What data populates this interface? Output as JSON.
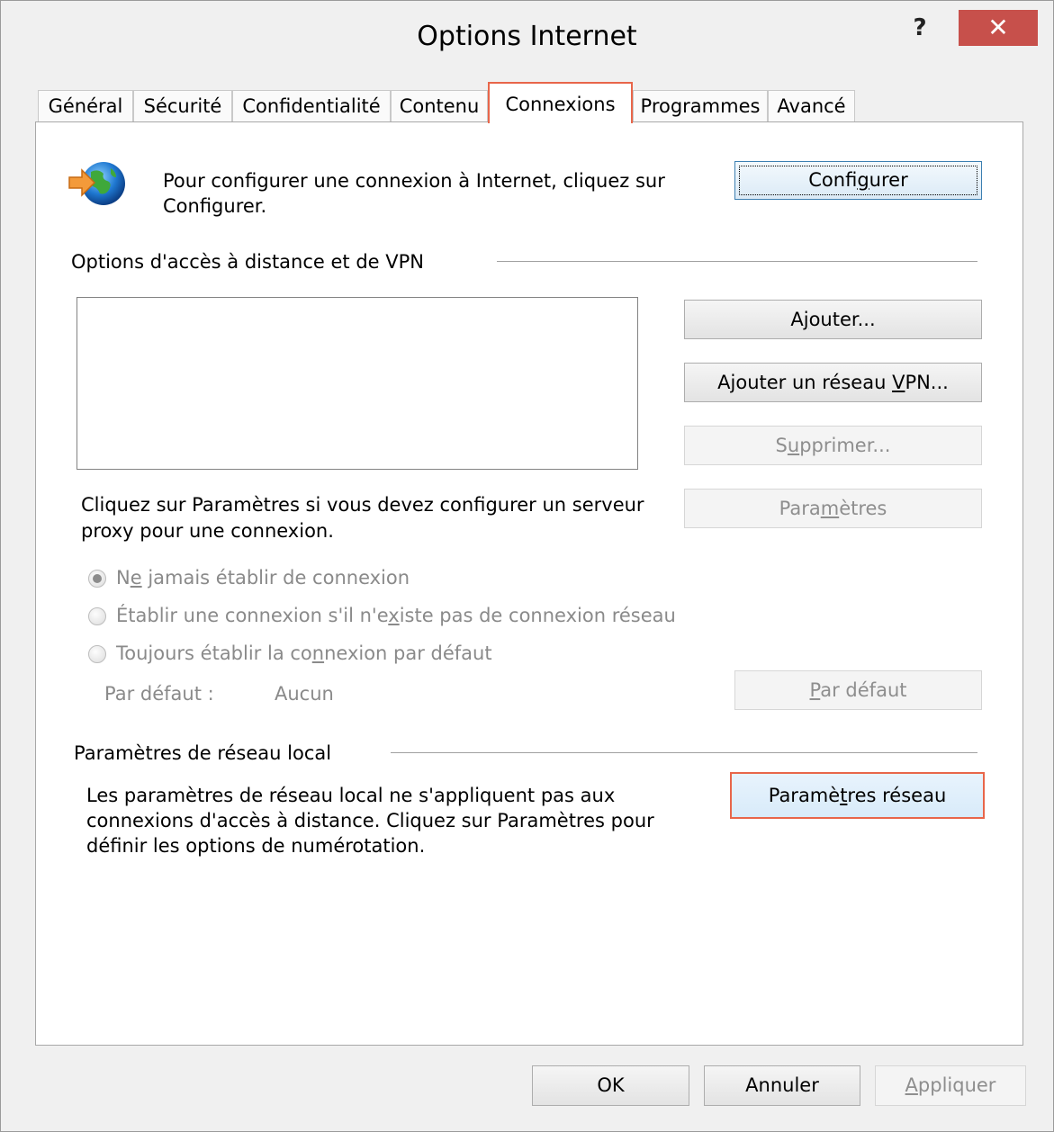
{
  "window": {
    "title": "Options Internet",
    "help_label": "?",
    "close_label": "✕"
  },
  "tabs": [
    {
      "label": "Général"
    },
    {
      "label": "Sécurité"
    },
    {
      "label": "Confidentialité"
    },
    {
      "label": "Contenu"
    },
    {
      "label": "Connexions",
      "active": true
    },
    {
      "label": "Programmes"
    },
    {
      "label": "Avancé"
    }
  ],
  "setup": {
    "text_line1": "Pour configurer une connexion à Internet, cliquez sur",
    "text_line2": "Configurer.",
    "button": {
      "before": "Confi",
      "key": "g",
      "after": "urer"
    }
  },
  "dialup": {
    "heading": "Options d'accès à distance et de VPN",
    "add_button": {
      "before": "A",
      "key": "j",
      "after": "outer..."
    },
    "add_vpn_button": {
      "before": "Ajouter un réseau ",
      "key": "V",
      "after": "PN..."
    },
    "remove_button": {
      "before": "S",
      "key": "u",
      "after": "pprimer..."
    },
    "settings_button": {
      "before": "Para",
      "key": "m",
      "after": "ètres"
    },
    "proxy_line1": "Cliquez sur Paramètres si vous devez configurer un serveur",
    "proxy_line2": "proxy pour une connexion.",
    "radios": [
      {
        "before": "N",
        "key": "e",
        "after": " jamais établir de connexion",
        "selected": true
      },
      {
        "before": "Établir une connexion s'il n'e",
        "key": "x",
        "after": "iste pas de connexion réseau",
        "selected": false
      },
      {
        "before": "Toujours établir la co",
        "key": "n",
        "after": "nexion par défaut",
        "selected": false
      }
    ],
    "default_label": "Par défaut :",
    "default_value": "Aucun",
    "default_button": {
      "before": "",
      "key": "P",
      "after": "ar défaut"
    }
  },
  "lan": {
    "heading": "Paramètres de réseau local",
    "line1": "Les paramètres de réseau local ne s'appliquent pas aux",
    "line2": "connexions d'accès à distance. Cliquez sur Paramètres pour",
    "line3": "définir les options de numérotation.",
    "button": {
      "before": "Paramè",
      "key": "t",
      "after": "res réseau"
    }
  },
  "footer": {
    "ok": "OK",
    "cancel": "Annuler",
    "apply": {
      "before": "",
      "key": "A",
      "after": "ppliquer"
    }
  },
  "colors": {
    "highlight": "#e8664a",
    "close_bg": "#c7504b",
    "disabled_text": "#8e8e8e"
  },
  "icons": {
    "globe": "globe-with-arrow-icon",
    "radio_selected": "radio-selected-icon",
    "radio_empty": "radio-empty-icon"
  }
}
